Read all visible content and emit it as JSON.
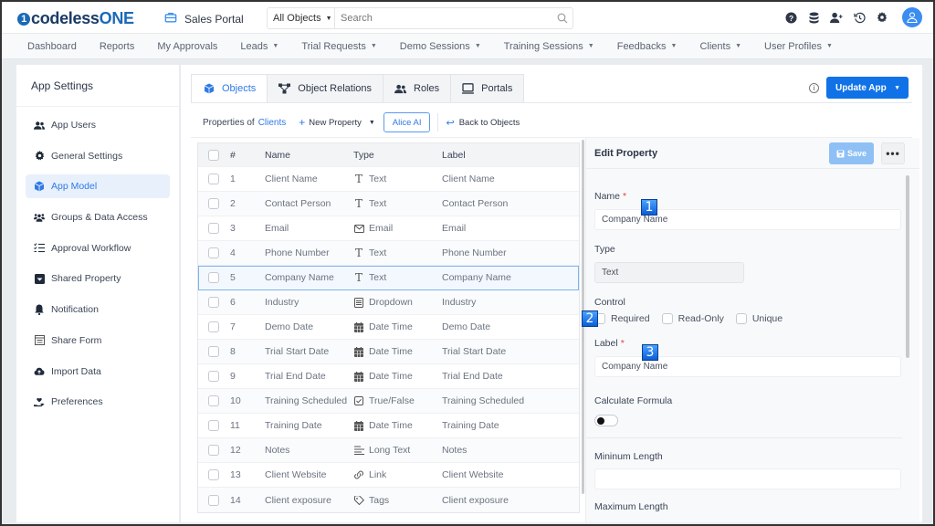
{
  "app": {
    "logo_mark": "1",
    "logo_text_1": "codeless",
    "logo_text_2": "ONE",
    "portal_name": "Sales Portal"
  },
  "search": {
    "scope": "All Objects",
    "placeholder": "Search"
  },
  "top_icons": [
    "help-icon",
    "database-icon",
    "add-user-icon",
    "history-icon",
    "settings-icon",
    "user-avatar-icon"
  ],
  "nav": [
    {
      "label": "Dashboard",
      "dropdown": false
    },
    {
      "label": "Reports",
      "dropdown": false
    },
    {
      "label": "My Approvals",
      "dropdown": false
    },
    {
      "label": "Leads",
      "dropdown": true
    },
    {
      "label": "Trial Requests",
      "dropdown": true
    },
    {
      "label": "Demo Sessions",
      "dropdown": true
    },
    {
      "label": "Training Sessions",
      "dropdown": true
    },
    {
      "label": "Feedbacks",
      "dropdown": true
    },
    {
      "label": "Clients",
      "dropdown": true
    },
    {
      "label": "User Profiles",
      "dropdown": true
    }
  ],
  "sidebar": {
    "title": "App Settings",
    "items": [
      {
        "label": "App Users",
        "icon": "users-icon",
        "active": false
      },
      {
        "label": "General Settings",
        "icon": "gear-icon",
        "active": false
      },
      {
        "label": "App Model",
        "icon": "cube-icon",
        "active": true
      },
      {
        "label": "Groups & Data Access",
        "icon": "groups-icon",
        "active": false
      },
      {
        "label": "Approval Workflow",
        "icon": "checklist-icon",
        "active": false
      },
      {
        "label": "Shared Property",
        "icon": "inbox-icon",
        "active": false
      },
      {
        "label": "Notification",
        "icon": "bell-icon",
        "active": false
      },
      {
        "label": "Share Form",
        "icon": "form-icon",
        "active": false
      },
      {
        "label": "Import Data",
        "icon": "cloud-upload-icon",
        "active": false
      },
      {
        "label": "Preferences",
        "icon": "hand-heart-icon",
        "active": false
      }
    ]
  },
  "tabs": [
    {
      "label": "Objects",
      "icon": "cube-icon",
      "active": true
    },
    {
      "label": "Object Relations",
      "icon": "relations-icon",
      "active": false
    },
    {
      "label": "Roles",
      "icon": "users-icon",
      "active": false
    },
    {
      "label": "Portals",
      "icon": "monitor-icon",
      "active": false
    }
  ],
  "toolbar": {
    "update_app": "Update App",
    "properties_of": "Properties of",
    "object_name": "Clients",
    "new_property": "New Property",
    "alice_ai": "Alice AI",
    "back_to_objects": "Back to Objects"
  },
  "table": {
    "columns": [
      "#",
      "Name",
      "Type",
      "Label"
    ],
    "rows": [
      {
        "num": "1",
        "name": "Client Name",
        "type": "Text",
        "type_icon": "text-icon",
        "label": "Client Name"
      },
      {
        "num": "2",
        "name": "Contact Person",
        "type": "Text",
        "type_icon": "text-icon",
        "label": "Contact Person"
      },
      {
        "num": "3",
        "name": "Email",
        "type": "Email",
        "type_icon": "envelope-icon",
        "label": "Email"
      },
      {
        "num": "4",
        "name": "Phone Number",
        "type": "Text",
        "type_icon": "text-icon",
        "label": "Phone Number"
      },
      {
        "num": "5",
        "name": "Company Name",
        "type": "Text",
        "type_icon": "text-icon",
        "label": "Company Name",
        "selected": true
      },
      {
        "num": "6",
        "name": "Industry",
        "type": "Dropdown",
        "type_icon": "dropdown-icon",
        "label": "Industry"
      },
      {
        "num": "7",
        "name": "Demo Date",
        "type": "Date Time",
        "type_icon": "calendar-icon",
        "label": "Demo Date"
      },
      {
        "num": "8",
        "name": "Trial Start Date",
        "type": "Date Time",
        "type_icon": "calendar-icon",
        "label": "Trial Start Date"
      },
      {
        "num": "9",
        "name": "Trial End Date",
        "type": "Date Time",
        "type_icon": "calendar-icon",
        "label": "Trial End Date"
      },
      {
        "num": "10",
        "name": "Training Scheduled",
        "type": "True/False",
        "type_icon": "checkbox-icon",
        "label": "Training Scheduled"
      },
      {
        "num": "11",
        "name": "Training Date",
        "type": "Date Time",
        "type_icon": "calendar-icon",
        "label": "Training Date"
      },
      {
        "num": "12",
        "name": "Notes",
        "type": "Long Text",
        "type_icon": "long-text-icon",
        "label": "Notes"
      },
      {
        "num": "13",
        "name": "Client Website",
        "type": "Link",
        "type_icon": "link-icon",
        "label": "Client Website"
      },
      {
        "num": "14",
        "name": "Client exposure",
        "type": "Tags",
        "type_icon": "tag-icon",
        "label": "Client exposure"
      }
    ]
  },
  "edit": {
    "title": "Edit Property",
    "save": "Save",
    "more": "•••",
    "name_label": "Name",
    "name_value": "Company Name",
    "type_label": "Type",
    "type_value": "Text",
    "control_label": "Control",
    "controls": [
      {
        "label": "Required",
        "checked": false
      },
      {
        "label": "Read-Only",
        "checked": false
      },
      {
        "label": "Unique",
        "checked": false
      }
    ],
    "label_label": "Label",
    "label_value": "Company Name",
    "formula_label": "Calculate Formula",
    "formula_on": false,
    "min_length_label": "Mininum Length",
    "min_length_value": "",
    "max_length_label": "Maximum Length",
    "required_mark": "*"
  },
  "markers": [
    "1",
    "2",
    "3"
  ]
}
